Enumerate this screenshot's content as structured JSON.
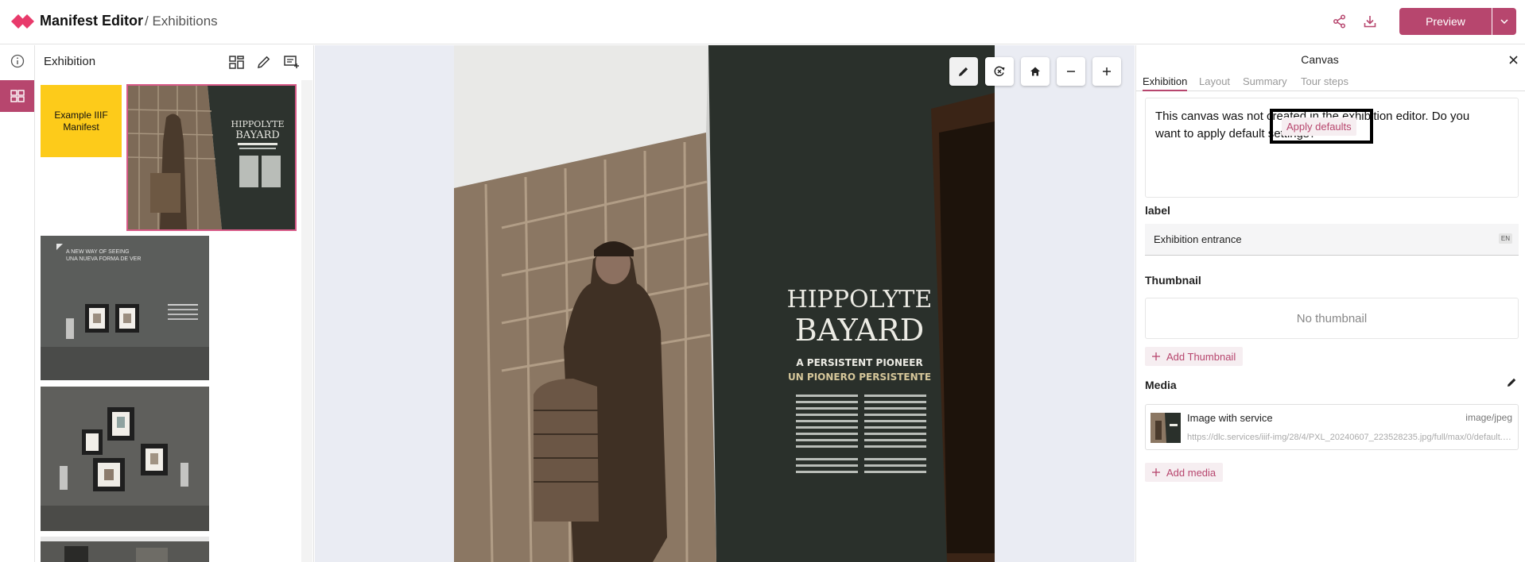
{
  "app": {
    "title": "Manifest Editor",
    "breadcrumb": "/ Exhibitions",
    "accent_color": "#b7466e"
  },
  "header": {
    "share_icon": "share-icon",
    "download_icon": "download-icon",
    "preview_label": "Preview",
    "preview_menu_icon": "chevron-down-icon"
  },
  "rail": {
    "items": [
      {
        "icon": "info-icon",
        "active": false
      },
      {
        "icon": "grid-icon",
        "active": true
      }
    ]
  },
  "outline": {
    "title": "Exhibition",
    "tools": [
      "layout-grid-icon",
      "edit-pencil-icon",
      "add-canvas-icon"
    ],
    "manifest_card_label": "Example IIIF Manifest",
    "manifest_card_color": "#fdcb1a",
    "selected_index": 0
  },
  "viewer": {
    "controls": [
      "edit-icon",
      "rotate-icon",
      "home-icon",
      "zoom-out-icon",
      "zoom-in-icon"
    ],
    "image_text": {
      "line1": "HIPPOLYTE",
      "line2": "BAYARD",
      "line3": "A PERSISTENT PIONEER",
      "line4": "UN PIONERO PERSISTENTE"
    },
    "thumb2_text": {
      "line1": "A NEW WAY OF SEEING",
      "line2": "UNA NUEVA FORMA DE VER"
    }
  },
  "right_panel": {
    "title": "Canvas",
    "tabs": [
      {
        "label": "Exhibition",
        "active": true
      },
      {
        "label": "Layout",
        "active": false
      },
      {
        "label": "Summary",
        "active": false
      },
      {
        "label": "Tour steps",
        "active": false
      }
    ],
    "notice": "This canvas was not created in the exhibition editor. Do you want to apply default settings?",
    "apply_defaults_label": "Apply defaults",
    "label_heading": "label",
    "label_value": "Exhibition entrance",
    "label_lang": "EN",
    "thumbnail_heading": "Thumbnail",
    "no_thumbnail": "No thumbnail",
    "add_thumbnail": "Add Thumbnail",
    "media_heading": "Media",
    "media": {
      "name": "Image with service",
      "type": "image/jpeg",
      "url": "https://dlc.services/iiif-img/28/4/PXL_20240607_223528235.jpg/full/max/0/default.jpg"
    },
    "add_media": "Add media"
  }
}
